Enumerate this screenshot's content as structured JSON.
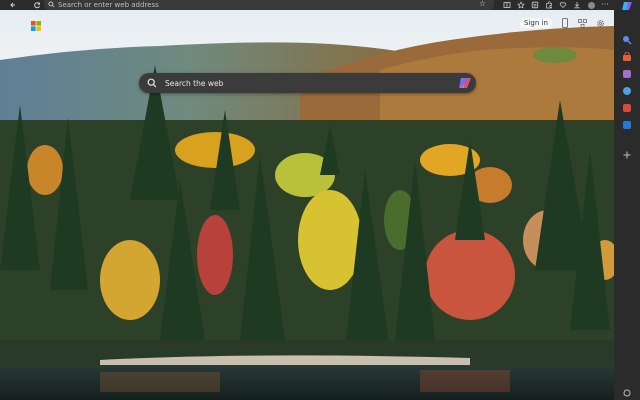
{
  "toolbar": {
    "address_placeholder": "Search or enter web address",
    "back_icon": "back-arrow-icon",
    "refresh_icon": "refresh-icon",
    "favorite_icon": "star-icon"
  },
  "newtab": {
    "search_placeholder": "Search the web",
    "signin_label": "Sign in"
  },
  "colors": {
    "toolbar_bg": "#2b2b2b",
    "address_bg": "#3a3a3a",
    "search_bg": "#3b3b3b",
    "sidebar_bg": "#2b2b2b"
  }
}
